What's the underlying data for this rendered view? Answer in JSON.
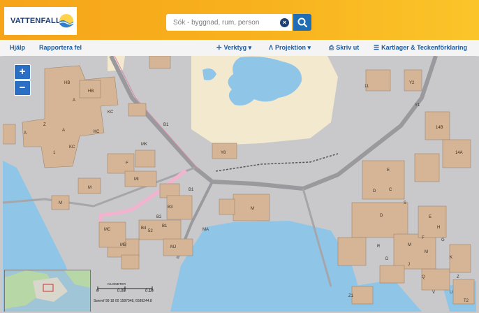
{
  "header": {
    "logo_text": "VATTENFALL",
    "search": {
      "placeholder": "Sök - byggnad, rum, person",
      "value": ""
    }
  },
  "toolbar": {
    "help": "Hjälp",
    "report": "Rapportera fel",
    "tools": "Verktyg",
    "projection": "Projektion",
    "print": "Skriv ut",
    "layers": "Kartlager & Teckenförklaring"
  },
  "map": {
    "zoom_in": "+",
    "zoom_out": "−",
    "building_labels": [
      "HB",
      "HB",
      "A",
      "KC",
      "KC",
      "A",
      "Z",
      "A",
      "KC",
      "1",
      "MK",
      "F",
      "M",
      "MI",
      "B1",
      "M",
      "B1",
      "B3",
      "B2",
      "B1",
      "MA",
      "MC",
      "MB",
      "52",
      "MJ",
      "B4",
      "Y8",
      "11",
      "Y2",
      "Y1",
      "14B",
      "14A",
      "E",
      "D",
      "C",
      "D",
      "S",
      "E",
      "F",
      "H",
      "M",
      "G",
      "M",
      "K",
      "D",
      "R",
      "J",
      "Q",
      "Z",
      "V",
      "U",
      "T2",
      "Z1",
      "M"
    ],
    "scale": {
      "title": "KILOMETER",
      "ticks": [
        "0",
        "0.05",
        "0.10"
      ]
    },
    "coords": "Sweref 99 18 00 1587048, 6589244.8"
  },
  "colors": {
    "header_orange": "#f8b21d",
    "nav_blue": "#1e5aa0",
    "water": "#8fc6e8",
    "land": "#f3e9cf",
    "building": "#d6b596",
    "ground": "#c9c9cb"
  }
}
